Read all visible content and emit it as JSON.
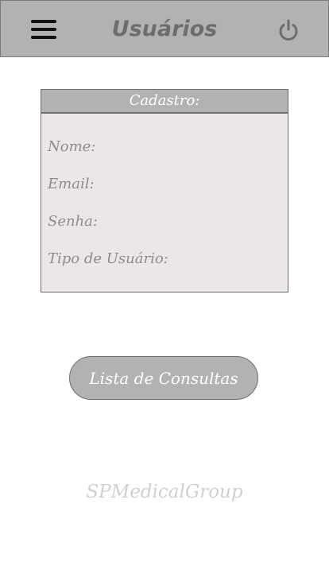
{
  "header": {
    "title": "Usuários",
    "menu_icon": "hamburger-menu-icon",
    "power_icon": "power-icon",
    "background_color": "#b2b2b2"
  },
  "form": {
    "title": "Cadastro:",
    "fields": [
      {
        "label": "Nome:"
      },
      {
        "label": "Email:"
      },
      {
        "label": "Senha:"
      },
      {
        "label": "Tipo de Usuário:"
      }
    ]
  },
  "actions": {
    "consultas_button_label": "Lista de Consultas"
  },
  "footer": {
    "brand": "SPMedicalGroup"
  }
}
